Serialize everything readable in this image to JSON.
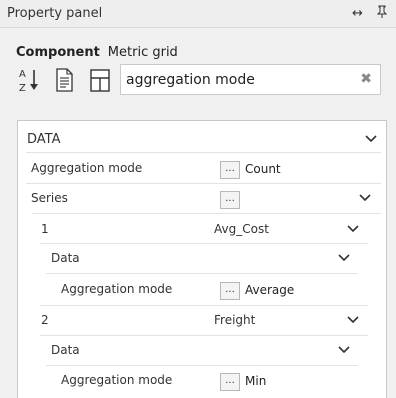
{
  "panel": {
    "title": "Property panel",
    "resize_glyph": "↔",
    "pin_glyph": "🖈"
  },
  "component": {
    "label": "Component",
    "value": "Metric grid"
  },
  "toolbar": {
    "icons": [
      "sort-az-icon",
      "document-icon",
      "page-layout-icon"
    ]
  },
  "search": {
    "value": "aggregation mode",
    "clear_glyph": "✖"
  },
  "section": {
    "title": "DATA"
  },
  "rows": {
    "aggregation_mode": {
      "label": "Aggregation mode",
      "button": "...",
      "value": "Count"
    },
    "series": {
      "label": "Series",
      "button": "..."
    },
    "series1": {
      "index": "1",
      "name": "Avg_Cost",
      "data_label": "Data",
      "agg_label": "Aggregation mode",
      "button": "...",
      "agg_value": "Average"
    },
    "series2": {
      "index": "2",
      "name": "Freight",
      "data_label": "Data",
      "agg_label": "Aggregation mode",
      "button": "...",
      "agg_value": "Min"
    }
  }
}
